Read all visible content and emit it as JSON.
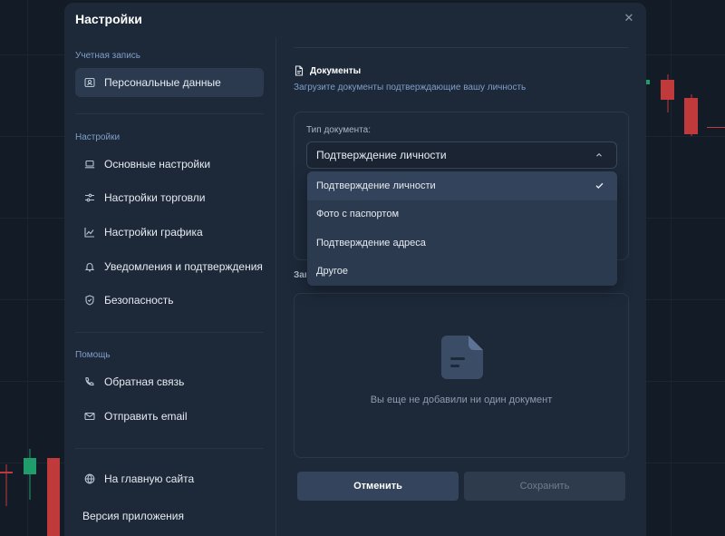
{
  "modal": {
    "title": "Настройки",
    "close_glyph": "✕"
  },
  "sidebar": {
    "sections": {
      "account": "Учетная запись",
      "settings": "Настройки",
      "help": "Помощь"
    },
    "items": [
      {
        "label": "Персональные данные",
        "icon": "user-card-icon",
        "active": true
      },
      {
        "label": "Основные настройки",
        "icon": "laptop-icon"
      },
      {
        "label": "Настройки торговли",
        "icon": "sliders-icon"
      },
      {
        "label": "Настройки графика",
        "icon": "chart-line-icon"
      },
      {
        "label": "Уведомления и подтверждения",
        "icon": "bell-icon"
      },
      {
        "label": "Безопасность",
        "icon": "shield-icon"
      },
      {
        "label": "Обратная связь",
        "icon": "phone-icon"
      },
      {
        "label": "Отправить email",
        "icon": "mail-icon"
      },
      {
        "label": "На главную сайта",
        "icon": "globe-icon"
      }
    ],
    "version_label": "Версия приложения"
  },
  "documents": {
    "heading": "Документы",
    "subtitle": "Загрузите документы подтверждающие вашу личность",
    "type_label": "Тип документа:",
    "selected": "Подтверждение личности",
    "options": [
      "Подтверждение личности",
      "Фото с паспортом",
      "Подтверждение адреса",
      "Другое"
    ],
    "upload_label_partial": "Заг",
    "empty_text": "Вы еще не добавили ни один документ"
  },
  "buttons": {
    "cancel": "Отменить",
    "save": "Сохранить"
  },
  "colors": {
    "accent": "#2c3a4f",
    "candle_up": "#1f9d6b",
    "candle_down": "#c0393b"
  }
}
